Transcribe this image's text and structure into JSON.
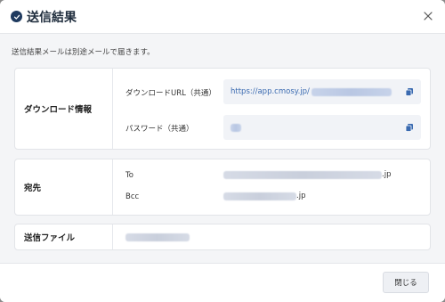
{
  "dialog": {
    "title": "送信結果",
    "description": "送信結果メールは別途メールで届きます。",
    "close_icon": "close-icon",
    "status_icon": "check-circle-icon"
  },
  "download": {
    "section_label": "ダウンロード情報",
    "url_label": "ダウンロードURL（共通）",
    "url_value": "https://app.cmosy.jp/",
    "password_label": "パスワード（共通）",
    "copy_icon": "copy-icon"
  },
  "recipients": {
    "section_label": "宛先",
    "to_label": "To",
    "to_suffix": ".jp",
    "bcc_label": "Bcc",
    "bcc_suffix": ".jp"
  },
  "files": {
    "section_label": "送信ファイル"
  },
  "footer": {
    "close_label": "閉じる"
  },
  "colors": {
    "accent": "#1f3a5f",
    "link": "#3a6ab0"
  }
}
